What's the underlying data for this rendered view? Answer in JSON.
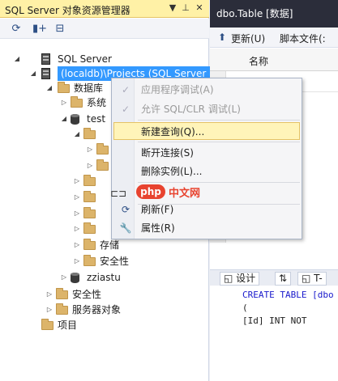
{
  "object_explorer": {
    "title": "SQL Server 对象资源管理器",
    "title_buttons": [
      "▼",
      "📌",
      "✕"
    ],
    "toolbar_icons": [
      "refresh-icon",
      "add-server-icon",
      "stop-icon"
    ],
    "tree": [
      {
        "label": "SQL Server",
        "icon": "server-icon",
        "expander": "◢"
      },
      {
        "label": "(localdb)\\Projects (SQL Server",
        "icon": "server-icon",
        "expander": "◢",
        "selected": true
      },
      {
        "label": "数据库",
        "icon": "folder-icon",
        "expander": "◢"
      },
      {
        "label": "系统",
        "icon": "folder-icon",
        "expander": "▷"
      },
      {
        "label": "test",
        "icon": "database-icon",
        "expander": "◢"
      },
      {
        "label": "",
        "icon": "folder-icon",
        "expander": "◢"
      },
      {
        "label": "",
        "icon": "folder-icon",
        "expander": "▷"
      },
      {
        "label": "",
        "icon": "folder-icon",
        "expander": "▷"
      },
      {
        "label": "",
        "icon": "folder-icon",
        "expander": "▷"
      },
      {
        "label": "",
        "icon": "folder-icon",
        "expander": "▷"
      },
      {
        "label": "",
        "icon": "folder-icon",
        "expander": "▷"
      },
      {
        "label": "",
        "icon": "folder-icon",
        "expander": "▷"
      },
      {
        "label": "",
        "icon": "folder-icon",
        "expander": "▷"
      },
      {
        "label": "存储",
        "icon": "folder-icon",
        "expander": "▷"
      },
      {
        "label": "安全性",
        "icon": "folder-icon",
        "expander": "▷"
      },
      {
        "label": "zziastu",
        "icon": "database-icon",
        "expander": "▷"
      },
      {
        "label": "安全性",
        "icon": "folder-icon",
        "expander": "▷"
      },
      {
        "label": "服务器对象",
        "icon": "folder-icon",
        "expander": "▷"
      },
      {
        "label": "项目",
        "icon": "folder-icon",
        "expander": ""
      }
    ]
  },
  "document": {
    "tab_title": "dbo.Table [数据]",
    "toolbar": {
      "update": "更新(U)",
      "script_file": "脚本文件(:"
    },
    "grid_header": "名称",
    "design_tabs": [
      "设计",
      "⇅",
      "T-"
    ],
    "sql_lines": [
      "CREATE TABLE [dbo",
      "(",
      "    [Id] INT NOT"
    ]
  },
  "context_menu": {
    "items": [
      {
        "label": "应用程序调试(A)",
        "icon": "check-icon",
        "disabled": true
      },
      {
        "label": "允许 SQL/CLR 调试(L)",
        "icon": "check-icon",
        "disabled": true
      },
      {
        "label": "新建查询(Q)...",
        "icon": "",
        "highlighted": true
      },
      {
        "label": "断开连接(S)",
        "icon": ""
      },
      {
        "label": "删除实例(L)...",
        "icon": ""
      },
      {
        "label": "",
        "icon": "",
        "is_watermark_row": true
      },
      {
        "label": "刷新(F)",
        "icon": "refresh-icon"
      },
      {
        "label": "属性(R)",
        "icon": "wrench-icon"
      }
    ]
  },
  "watermark": {
    "badge": "php",
    "text": "中文网"
  },
  "colors": {
    "title_bar": "#fff1a6",
    "selection": "#3399ff",
    "dark_tab": "#2b2d3a",
    "menu_hover": "#fff4b9"
  }
}
